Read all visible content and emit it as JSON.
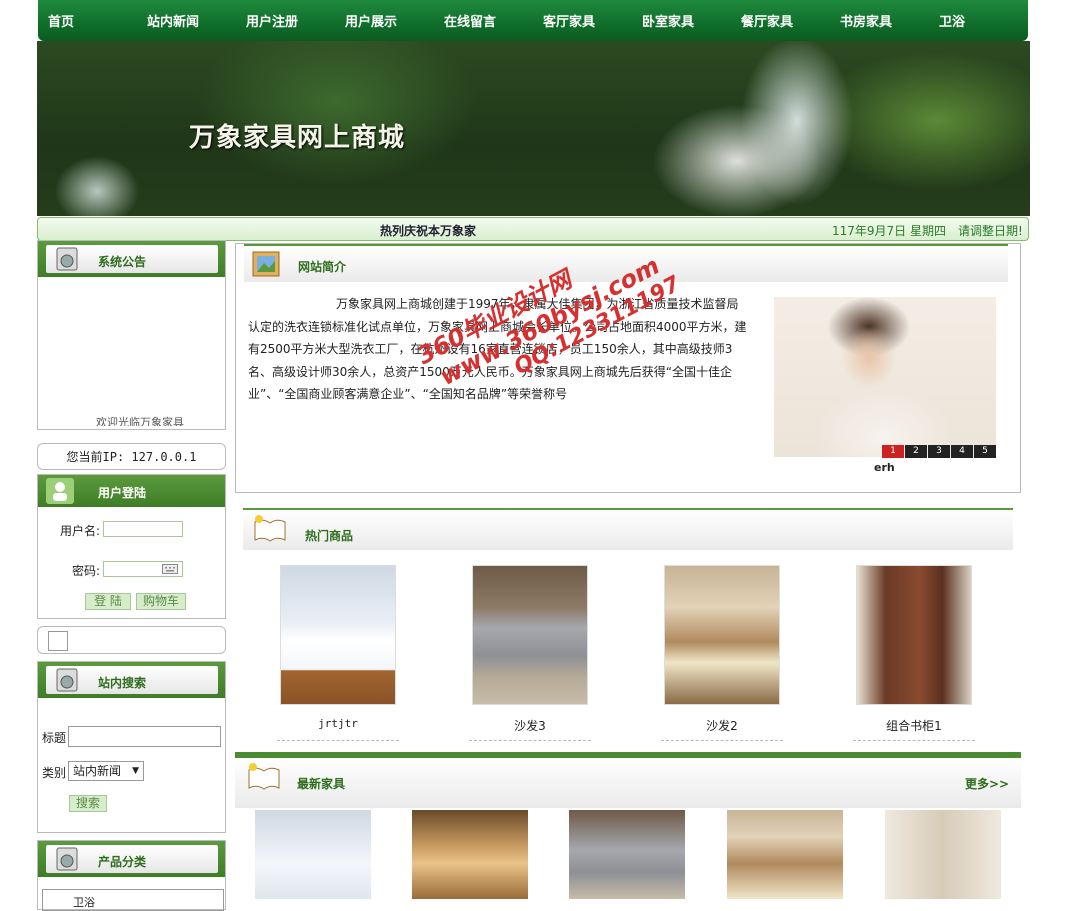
{
  "nav": [
    "首页",
    "站内新闻",
    "用户注册",
    "用户展示",
    "在线留言",
    "客厅家具",
    "卧室家具",
    "餐厅家具",
    "书房家具",
    "卫浴"
  ],
  "banner_title": "万象家具网上商城",
  "ticker": "热列庆祝本万象家",
  "date": "117年9月7日 星期四",
  "date_notice": "请调整日期!",
  "notice": {
    "title": "系统公告",
    "scroll_text": "欢迎光临万象家具"
  },
  "ip": "您当前IP: 127.0.0.1",
  "login": {
    "title": "用户登陆",
    "username_label": "用户名:",
    "password_label": "密码:",
    "login_button": "登 陆",
    "cart_button": "购物车"
  },
  "search": {
    "title": "站内搜索",
    "title_label": "标题",
    "type_label": "类别",
    "type_value": "站内新闻",
    "button": "搜索"
  },
  "categories": {
    "title": "产品分类",
    "first": "卫浴"
  },
  "intro": {
    "title": "网站简介",
    "text": "万象家具网上商城创建于1997年，隶属大佳集团，为浙江省质量技术监督局认定的洗衣连锁标准化试点单位，万象家具网上商城会长单位。公司占地面积4000平方米，建有2500平方米大型洗衣工厂，在杭州设有16家直营连锁店，员工150余人，其中高级技师3名、高级设计师30余人，总资产1500万元人民币。万象家具网上商城先后获得“全国十佳企业”、“全国商业顾客满意企业”、“全国知名品牌”等荣誉称号",
    "photo_caption": "erh",
    "photo_pages": [
      "1",
      "2",
      "3",
      "4",
      "5"
    ]
  },
  "hot": {
    "title": "热门商品",
    "items": [
      "jrtjtr",
      "沙发3",
      "沙发2",
      "组合书柜1"
    ]
  },
  "latest": {
    "title": "最新家具",
    "more": "更多>>"
  },
  "watermark": {
    "line1": "360毕业设计网",
    "line2": "www.360bysj.com",
    "line3": "QQ:123311197"
  }
}
